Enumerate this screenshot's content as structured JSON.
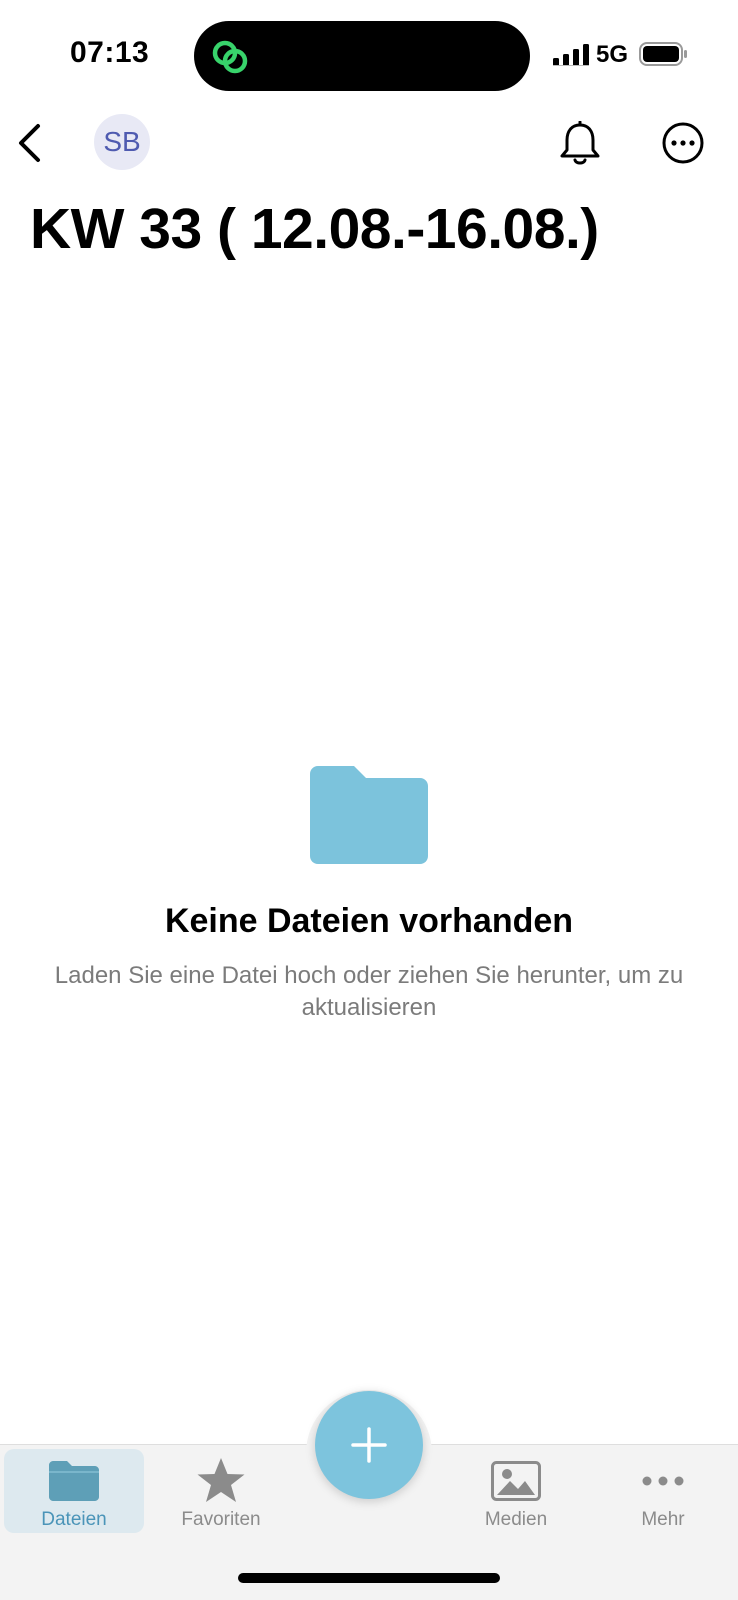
{
  "status_bar": {
    "time": "07:13",
    "network": "5G"
  },
  "nav": {
    "avatar_initials": "SB",
    "back_icon": "chevron-left-icon",
    "bell_icon": "bell-icon",
    "more_icon": "ellipsis-circle-icon"
  },
  "page": {
    "title": "KW 33 ( 12.08.-16.08.)"
  },
  "empty_state": {
    "icon": "folder-icon",
    "title": "Keine Dateien vorhanden",
    "description": "Laden Sie eine Datei hoch oder ziehen Sie herunter, um zu aktualisieren"
  },
  "tab_bar": {
    "tabs": [
      {
        "label": "Dateien",
        "icon": "folder-icon",
        "active": true
      },
      {
        "label": "Favoriten",
        "icon": "star-icon",
        "active": false
      },
      {
        "label": "Medien",
        "icon": "image-icon",
        "active": false
      },
      {
        "label": "Mehr",
        "icon": "more-horizontal-icon",
        "active": false
      }
    ],
    "fab_icon": "plus-icon"
  },
  "colors": {
    "accent": "#7dc4dd",
    "folder": "#7cc3dc",
    "active_tab_bg": "#dde9ef",
    "active_tab_text": "#4a94b8",
    "avatar_bg": "#e8e9f5",
    "avatar_text": "#4f5bb0"
  }
}
